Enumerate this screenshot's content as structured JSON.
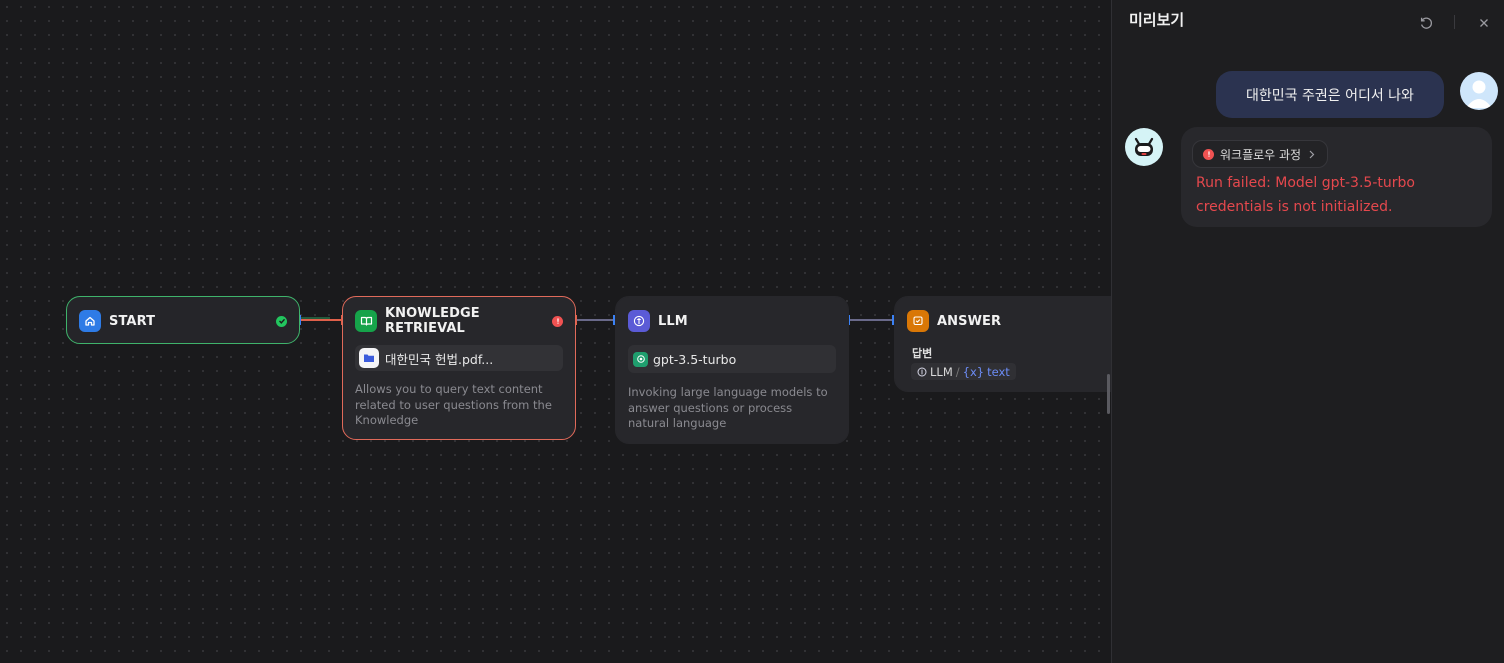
{
  "colors": {
    "start_accent": "#2e7be6",
    "knowledge_accent": "#16a34a",
    "llm_accent": "#5b5bd6",
    "answer_accent": "#d97706",
    "success": "#22c55e",
    "error": "#f05252",
    "error_text": "#e5484d"
  },
  "nodes": {
    "start": {
      "title": "START",
      "icon": "home-icon",
      "status": "success"
    },
    "knowledge": {
      "title": "KNOWLEDGE RETRIEVAL",
      "icon": "book-icon",
      "status": "error",
      "dataset": "대한민국 헌법.pdf...",
      "description": "Allows you to query text content related to user questions from the Knowledge"
    },
    "llm": {
      "title": "LLM",
      "icon": "llm-icon",
      "model": "gpt-3.5-turbo",
      "description": "Invoking large language models to answer questions or process natural language"
    },
    "answer": {
      "title": "ANSWER",
      "icon": "answer-icon",
      "field_label": "답변",
      "var_source": "LLM",
      "var_separator": "/",
      "var_symbol": "{x}",
      "var_name": "text"
    }
  },
  "preview": {
    "title": "미리보기",
    "user_message": "대한민국 주권은 어디서 나와",
    "workflow_label": "워크플로우 과정",
    "error_message": "Run failed: Model gpt-3.5-turbo credentials is not initialized."
  }
}
